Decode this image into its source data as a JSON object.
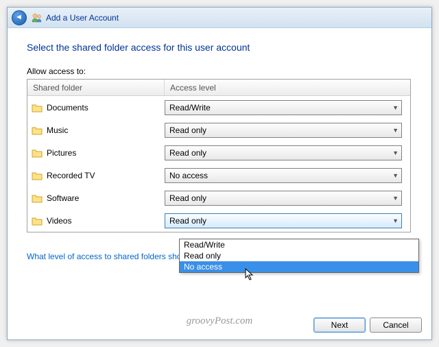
{
  "titlebar": {
    "title": "Add a User Account"
  },
  "heading": "Select the shared folder access for this user account",
  "subheading": "Allow access to:",
  "columns": {
    "folder": "Shared folder",
    "access": "Access level"
  },
  "rows": [
    {
      "name": "Documents",
      "level": "Read/Write"
    },
    {
      "name": "Music",
      "level": "Read only"
    },
    {
      "name": "Pictures",
      "level": "Read only"
    },
    {
      "name": "Recorded TV",
      "level": "No access"
    },
    {
      "name": "Software",
      "level": "Read only"
    },
    {
      "name": "Videos",
      "level": "Read only"
    }
  ],
  "dropdown_options": [
    {
      "label": "Read/Write",
      "highlighted": false
    },
    {
      "label": "Read only",
      "highlighted": false
    },
    {
      "label": "No access",
      "highlighted": true
    }
  ],
  "helplink": "What level of access to shared folders should I allow?",
  "buttons": {
    "next": "Next",
    "cancel": "Cancel"
  },
  "watermark": "groovyPost.com"
}
